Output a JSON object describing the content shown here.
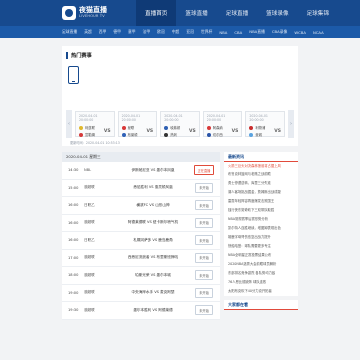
{
  "header": {
    "logo_cn": "夜猫直播",
    "logo_en": "LIVEHOUR TV",
    "nav": [
      "直播首页",
      "篮球直播",
      "足球直播",
      "篮球录像",
      "足球集锦"
    ],
    "active_nav": 0
  },
  "subnav": [
    "足球直播",
    "英超",
    "西甲",
    "德甲",
    "意甲",
    "法甲",
    "欧冠",
    "中超",
    "亚冠",
    "世界杯",
    "欧洲杯",
    "NBA",
    "CBA",
    "WCBA",
    "NCAA",
    "CBA直播",
    "NBA直播",
    "CBA录像",
    "WCBA",
    "NCAA"
  ],
  "hot": {
    "title": "热门赛事",
    "updated": "更新时间：2020-04-01 10:53:13",
    "cards": [
      {
        "time": "2020-04-01 20:00:00",
        "home": "利兹联",
        "away": "富勒姆",
        "home_color": "#e0b92e",
        "away_color": "#d63a3a"
      },
      {
        "time": "2020-04-01 20:00:00",
        "home": "曼联",
        "away": "布莱顿",
        "home_color": "#d93838",
        "away_color": "#2f61b7"
      },
      {
        "time": "2020-04-01 20:00:00",
        "home": "埃弗顿",
        "away": "热刺",
        "home_color": "#2d5fb3",
        "away_color": "#333"
      },
      {
        "time": "2020-04-01 20:00:00",
        "home": "阿森纳",
        "away": "切尔西",
        "home_color": "#d93838",
        "away_color": "#2a54a8"
      },
      {
        "time": "2020-04-01 20:00:00",
        "home": "利物浦",
        "away": "曼城",
        "home_color": "#c92d2d",
        "away_color": "#5aa3e0"
      }
    ]
  },
  "schedule": {
    "heading": "2020-04-01 星期三",
    "rows": [
      {
        "time": "14:30",
        "league": "NBL",
        "match": "伊斯帕尼亚 VS 墨尔本凤凰",
        "action": "正在直播",
        "live": true
      },
      {
        "time": "15:00",
        "league": "澳超联",
        "match": "悉尼胜利 VS 惠灵顿凤凰",
        "action": "未开始",
        "live": false
      },
      {
        "time": "16:00",
        "league": "日职乙",
        "match": "横滨FC VS 山形山神",
        "action": "未开始",
        "live": false
      },
      {
        "time": "16:00",
        "league": "澳超联",
        "match": "阿德莱德联 VS 纽卡斯尔喷气机",
        "action": "未开始",
        "live": false
      },
      {
        "time": "16:00",
        "league": "日职乙",
        "match": "札幌冈萨多 VS 鹿岛鹿角",
        "action": "未开始",
        "live": false
      },
      {
        "time": "17:00",
        "league": "澳超联",
        "match": "西悉尼流浪者 VS 布里斯班狮吼",
        "action": "未开始",
        "live": false
      },
      {
        "time": "18:00",
        "league": "澳超联",
        "match": "珀斯光荣 VS 墨尔本城",
        "action": "未开始",
        "live": false
      },
      {
        "time": "19:00",
        "league": "澳超联",
        "match": "中央海岸水手 VS 麦克阿瑟",
        "action": "未开始",
        "live": false
      },
      {
        "time": "19:30",
        "league": "澳超联",
        "match": "墨尔本胜利 VS 阿德莱德",
        "action": "未开始",
        "live": false
      }
    ]
  },
  "sidebar": {
    "news_title": "最新资讯",
    "news": [
      "火箭三巨头对决森林狼谁将占据上风",
      "布鲁克林篮网与老鹰之战前瞻",
      "勇士惨遭逆转，库里三分失准",
      "湖人客场挑战掘金，詹姆斯出战成疑",
      "雷霆年轻阵容再度爆发击败国王",
      "独行侠东契奇砍下三双带队取胜",
      "NBA常规赛季后赛形势分析",
      "凯尔特人连胜继续，塔图姆表现出色",
      "雄鹿字母哥伤愈复出战力提升",
      "快船哈登：球队需要更多专注",
      "NBA全明星正赛投票结果公布",
      "2020NBA选秀大会前瞻球员解析",
      "东部排名竞争激烈 各队势均力敌",
      "76人恩比德缺阵 球队连败",
      "太阳布克砍下40分力克开拓者"
    ],
    "more_title": "大家都在看"
  }
}
